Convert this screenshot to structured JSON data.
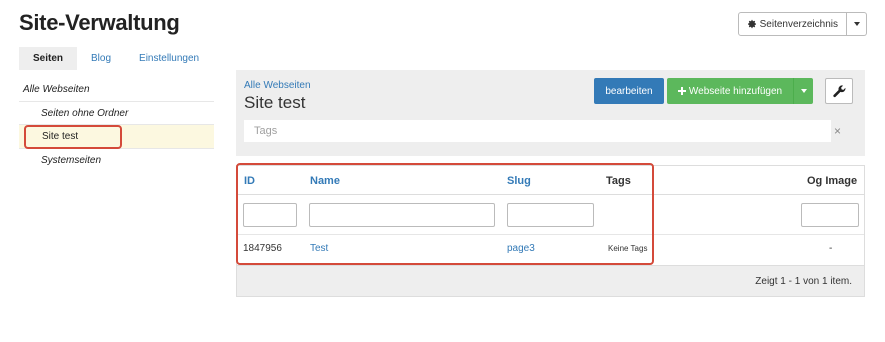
{
  "page": {
    "title": "Site-Verwaltung"
  },
  "sitemap_button": {
    "label": "Seitenverzeichnis",
    "icon": "gear-icon"
  },
  "tabs": [
    {
      "label": "Seiten",
      "active": true
    },
    {
      "label": "Blog",
      "active": false
    },
    {
      "label": "Einstellungen",
      "active": false
    }
  ],
  "sidebar": {
    "items": [
      {
        "label": "Alle Webseiten"
      },
      {
        "label": "Seiten ohne Ordner"
      },
      {
        "label": "Site test",
        "active": true
      },
      {
        "label": "Systemseiten"
      }
    ]
  },
  "panel": {
    "breadcrumb": "Alle Webseiten",
    "title": "Site test",
    "edit_label": "bearbeiten",
    "add_label": "Webseite hinzufügen",
    "tags_placeholder": "Tags",
    "tags_clear": "×"
  },
  "grid": {
    "columns": {
      "id": "ID",
      "name": "Name",
      "slug": "Slug",
      "tags": "Tags",
      "og_image": "Og Image"
    },
    "rows": [
      {
        "id": "1847956",
        "name": "Test",
        "slug": "page3",
        "tags": "Keine Tags",
        "og_image": "-"
      }
    ],
    "pager_info": "Zeigt 1 - 1 von 1 item."
  },
  "colors": {
    "primary": "#337ab7",
    "success": "#5cb85c",
    "highlight": "#d44a3a",
    "selected_row": "#fcf8e0"
  }
}
